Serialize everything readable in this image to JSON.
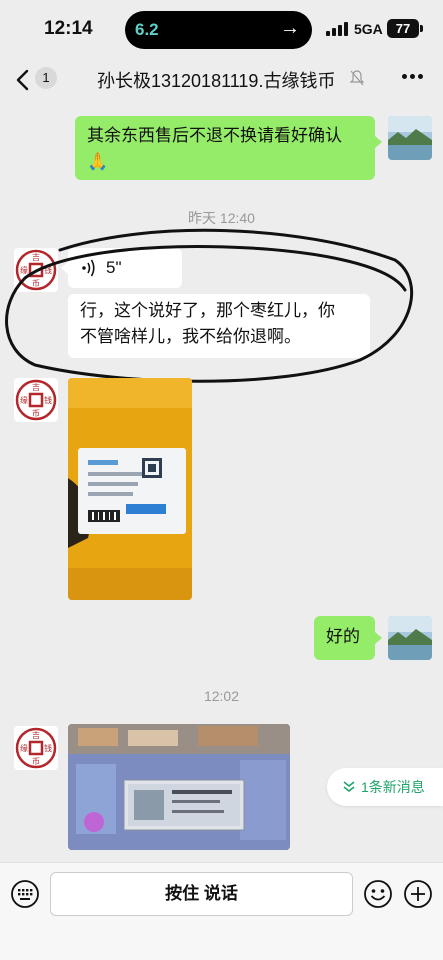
{
  "status_bar": {
    "time": "12:14",
    "island_text": "6.2",
    "network": "5GA",
    "battery": "77"
  },
  "nav": {
    "back_badge": "1",
    "title": "孙长极13120181119.古缘钱币"
  },
  "messages": {
    "m1_text": "其余东西售后不退不换请看好确认🙏",
    "ts1": "昨天 12:40",
    "voice_duration": "5\"",
    "m2_line1": "行，这个说好了，那个枣红儿，你",
    "m2_line2": "不管啥样儿，我不给你退啊。",
    "m4_text": "好的",
    "ts2": "12:02"
  },
  "new_messages_pill": "1条新消息",
  "input_bar": {
    "talk_label": "按住 说话"
  },
  "colors": {
    "outgoing_bubble": "#95ec69",
    "incoming_bubble": "#ffffff",
    "chat_background": "#ededed",
    "accent_green": "#21a36b"
  },
  "avatar_logo_text": "吉缘钱币"
}
